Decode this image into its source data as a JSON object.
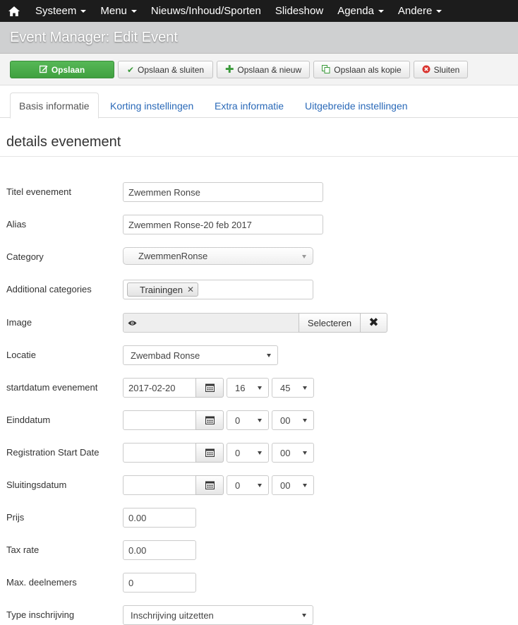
{
  "nav": {
    "items": [
      {
        "label": "Systeem",
        "dropdown": true
      },
      {
        "label": "Menu",
        "dropdown": true
      },
      {
        "label": "Nieuws/Inhoud/Sporten",
        "dropdown": false
      },
      {
        "label": "Slideshow",
        "dropdown": false
      },
      {
        "label": "Agenda",
        "dropdown": true
      },
      {
        "label": "Andere",
        "dropdown": true
      }
    ]
  },
  "page_title": "Event Manager: Edit Event",
  "toolbar": {
    "save": "Opslaan",
    "save_close": "Opslaan & sluiten",
    "save_new": "Opslaan & nieuw",
    "save_copy": "Opslaan als kopie",
    "close": "Sluiten"
  },
  "tabs": [
    "Basis informatie",
    "Korting instellingen",
    "Extra informatie",
    "Uitgebreide instellingen"
  ],
  "section_title": "details evenement",
  "form": {
    "title": {
      "label": "Titel evenement",
      "value": "Zwemmen Ronse"
    },
    "alias": {
      "label": "Alias",
      "value": "Zwemmen Ronse-20 feb 2017"
    },
    "category": {
      "label": "Category",
      "value": "ZwemmenRonse"
    },
    "additional_categories": {
      "label": "Additional categories",
      "tag": "Trainingen"
    },
    "image": {
      "label": "Image",
      "select_button": "Selecteren",
      "clear_button": "✖"
    },
    "location": {
      "label": "Locatie",
      "value": "Zwembad Ronse"
    },
    "start_date": {
      "label": "startdatum evenement",
      "date": "2017-02-20",
      "hour": "16",
      "minute": "45"
    },
    "end_date": {
      "label": "Einddatum",
      "date": "",
      "hour": "0",
      "minute": "00"
    },
    "registration_start": {
      "label": "Registration Start Date",
      "date": "",
      "hour": "0",
      "minute": "00"
    },
    "closing_date": {
      "label": "Sluitingsdatum",
      "date": "",
      "hour": "0",
      "minute": "00"
    },
    "price": {
      "label": "Prijs",
      "value": "0.00"
    },
    "tax_rate": {
      "label": "Tax rate",
      "value": "0.00"
    },
    "max_participants": {
      "label": "Max. deelnemers",
      "value": "0"
    },
    "registration_type": {
      "label": "Type inschrijving",
      "value": "Inschrijving uitzetten"
    }
  },
  "colors": {
    "navbar": "#1c1c1c",
    "primary_button": "#46a546",
    "link": "#2a69b8",
    "titlebar": "#cfd0d1"
  },
  "icons": [
    "home-icon",
    "edit-icon",
    "check-icon",
    "plus-icon",
    "copy-icon",
    "close-circle-icon",
    "eye-icon",
    "calendar-icon"
  ]
}
